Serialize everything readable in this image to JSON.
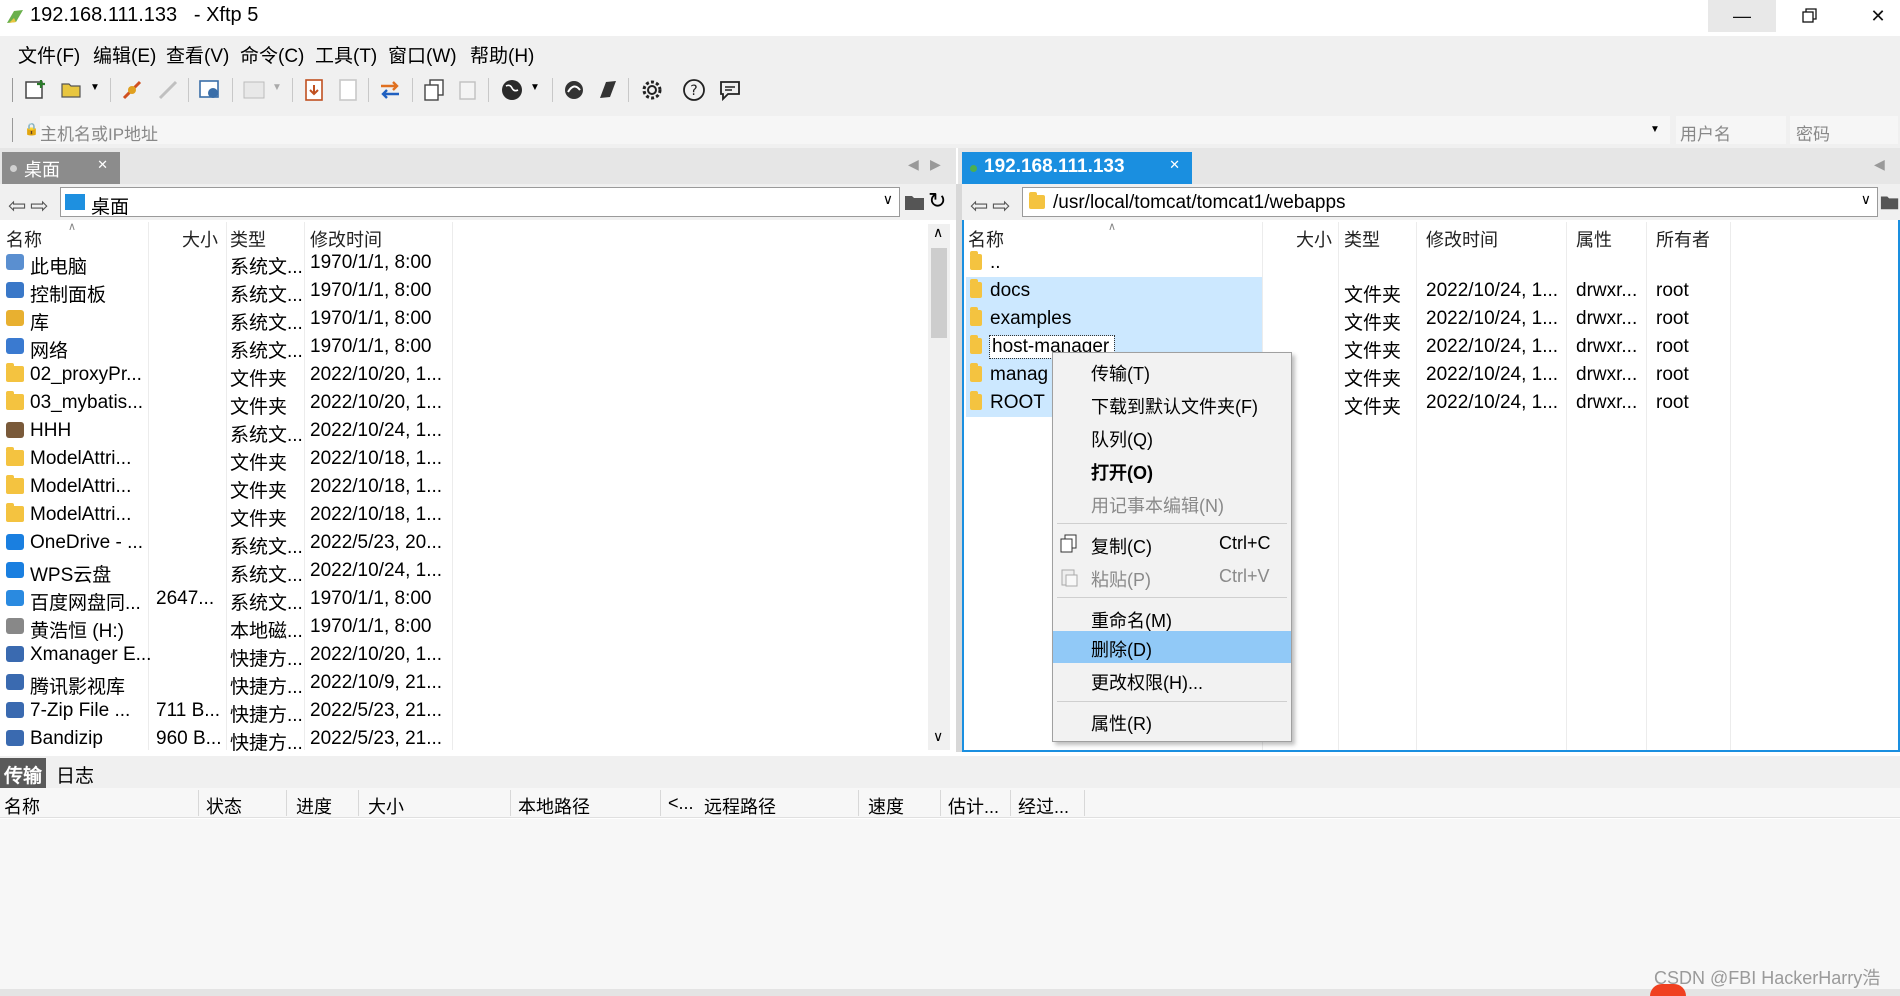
{
  "window": {
    "title": "192.168.111.133   - Xftp 5"
  },
  "menu": [
    "文件(F)",
    "编辑(E)",
    "查看(V)",
    "命令(C)",
    "工具(T)",
    "窗口(W)",
    "帮助(H)"
  ],
  "address": {
    "host_placeholder": "主机名或IP地址",
    "user_placeholder": "用户名",
    "password_placeholder": "密码"
  },
  "left": {
    "tab": "桌面",
    "path": "桌面",
    "columns": [
      "名称",
      "大小",
      "类型",
      "修改时间"
    ],
    "rows": [
      {
        "name": "此电脑",
        "size": "",
        "type": "系统文...",
        "mtime": "1970/1/1, 8:00",
        "icon": "computer-icon"
      },
      {
        "name": "控制面板",
        "size": "",
        "type": "系统文...",
        "mtime": "1970/1/1, 8:00",
        "icon": "control-panel-icon"
      },
      {
        "name": "库",
        "size": "",
        "type": "系统文...",
        "mtime": "1970/1/1, 8:00",
        "icon": "library-icon"
      },
      {
        "name": "网络",
        "size": "",
        "type": "系统文...",
        "mtime": "1970/1/1, 8:00",
        "icon": "network-icon"
      },
      {
        "name": "02_proxyPr...",
        "size": "",
        "type": "文件夹",
        "mtime": "2022/10/20, 1...",
        "icon": "folder-icon"
      },
      {
        "name": "03_mybatis...",
        "size": "",
        "type": "文件夹",
        "mtime": "2022/10/20, 1...",
        "icon": "folder-icon"
      },
      {
        "name": "HHH",
        "size": "",
        "type": "系统文...",
        "mtime": "2022/10/24, 1...",
        "icon": "user-icon"
      },
      {
        "name": "ModelAttri...",
        "size": "",
        "type": "文件夹",
        "mtime": "2022/10/18, 1...",
        "icon": "folder-icon"
      },
      {
        "name": "ModelAttri...",
        "size": "",
        "type": "文件夹",
        "mtime": "2022/10/18, 1...",
        "icon": "folder-icon"
      },
      {
        "name": "ModelAttri...",
        "size": "",
        "type": "文件夹",
        "mtime": "2022/10/18, 1...",
        "icon": "folder-icon"
      },
      {
        "name": "OneDrive - ...",
        "size": "",
        "type": "系统文...",
        "mtime": "2022/5/23, 20...",
        "icon": "cloud-icon"
      },
      {
        "name": "WPS云盘",
        "size": "",
        "type": "系统文...",
        "mtime": "2022/10/24, 1...",
        "icon": "cloud-icon"
      },
      {
        "name": "百度网盘同...",
        "size": "2647...",
        "type": "系统文...",
        "mtime": "1970/1/1, 8:00",
        "icon": "baidu-icon"
      },
      {
        "name": "黄浩恒 (H:)",
        "size": "",
        "type": "本地磁...",
        "mtime": "1970/1/1, 8:00",
        "icon": "drive-icon"
      },
      {
        "name": "Xmanager E...",
        "size": "",
        "type": "快捷方...",
        "mtime": "2022/10/20, 1...",
        "icon": "shortcut-icon"
      },
      {
        "name": "腾讯影视库",
        "size": "",
        "type": "快捷方...",
        "mtime": "2022/10/9, 21...",
        "icon": "shortcut-icon"
      },
      {
        "name": "7-Zip File ...",
        "size": "711 B...",
        "type": "快捷方...",
        "mtime": "2022/5/23, 21...",
        "icon": "shortcut-icon"
      },
      {
        "name": "Bandizip",
        "size": "960 B...",
        "type": "快捷方...",
        "mtime": "2022/5/23, 21...",
        "icon": "shortcut-icon"
      }
    ]
  },
  "right": {
    "tab": "192.168.111.133",
    "path": "/usr/local/tomcat/tomcat1/webapps",
    "columns": [
      "名称",
      "大小",
      "类型",
      "修改时间",
      "属性",
      "所有者"
    ],
    "rows": [
      {
        "name": "..",
        "type": "",
        "mtime": "",
        "attr": "",
        "owner": ""
      },
      {
        "name": "docs",
        "type": "文件夹",
        "mtime": "2022/10/24, 1...",
        "attr": "drwxr...",
        "owner": "root"
      },
      {
        "name": "examples",
        "type": "文件夹",
        "mtime": "2022/10/24, 1...",
        "attr": "drwxr...",
        "owner": "root"
      },
      {
        "name": "host-manager",
        "type": "文件夹",
        "mtime": "2022/10/24, 1...",
        "attr": "drwxr...",
        "owner": "root"
      },
      {
        "name": "manag",
        "type": "文件夹",
        "mtime": "2022/10/24, 1...",
        "attr": "drwxr...",
        "owner": "root"
      },
      {
        "name": "ROOT",
        "type": "文件夹",
        "mtime": "2022/10/24, 1...",
        "attr": "drwxr...",
        "owner": "root"
      }
    ]
  },
  "context_menu": {
    "transfer": "传输(T)",
    "download_default": "下载到默认文件夹(F)",
    "queue": "队列(Q)",
    "open": "打开(O)",
    "edit_notepad": "用记事本编辑(N)",
    "copy": "复制(C)",
    "copy_shortcut": "Ctrl+C",
    "paste": "粘贴(P)",
    "paste_shortcut": "Ctrl+V",
    "rename": "重命名(M)",
    "delete": "删除(D)",
    "chmod": "更改权限(H)...",
    "properties": "属性(R)"
  },
  "bottom": {
    "tabs": [
      "传输",
      "日志"
    ],
    "columns": [
      "名称",
      "状态",
      "进度",
      "大小",
      "本地路径",
      "<...",
      "远程路径",
      "速度",
      "估计...",
      "经过..."
    ]
  },
  "watermark": "CSDN @FBI HackerHarry浩",
  "colors": {
    "accent_tab": "#1a8fe0",
    "selection": "#cce8ff",
    "menu_highlight": "#91c9f7",
    "folder": "#f4c340"
  }
}
